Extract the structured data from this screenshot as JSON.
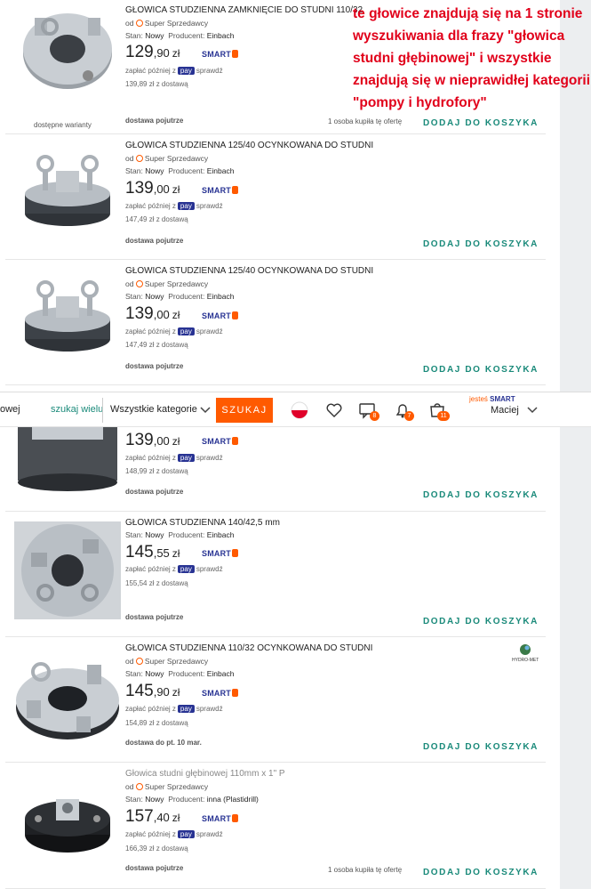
{
  "annotation": "te głowice znajdują się na 1 stronie wyszukiwania dla frazy \"głowica studni głębinowej\" i wszystkie znajdują się w nieprawidłej kategorii \"pompy i hydrofory\"",
  "common": {
    "seller_prefix": "od",
    "seller": "Super Sprzedawcy",
    "condition_label": "Stan:",
    "condition": "Nowy",
    "producer_label": "Producent:",
    "currency": "zł",
    "smart": "SMART",
    "pay_later_before": "zapłać później z",
    "pay": "pay",
    "pay_later_after": "sprawdź",
    "add_to_cart": "DODAJ DO KOSZYKA"
  },
  "listings": [
    {
      "title": "GŁOWICA STUDZIENNA ZAMKNIĘCIE DO STUDNI 110/32",
      "producer": "Einbach",
      "price_int": "129",
      "price_dec": ",90",
      "with_delivery": "139,89 zł z dostawą",
      "delivery": "dostawa pojutrze",
      "bought": "1 osoba kupiła tę ofertę",
      "variants": "dostępne warianty"
    },
    {
      "title": "GŁOWICA STUDZIENNA 125/40 OCYNKOWANA DO STUDNI",
      "producer": "Einbach",
      "price_int": "139",
      "price_dec": ",00",
      "with_delivery": "147,49 zł z dostawą",
      "delivery": "dostawa pojutrze"
    },
    {
      "title": "GŁOWICA STUDZIENNA 125/40 OCYNKOWANA DO STUDNI",
      "producer": "Einbach",
      "price_int": "139",
      "price_dec": ",00",
      "with_delivery": "147,49 zł z dostawą",
      "delivery": "dostawa pojutrze"
    },
    {
      "price_int": "139",
      "price_dec": ",00",
      "with_delivery": "148,99 zł z dostawą",
      "delivery": "dostawa pojutrze"
    },
    {
      "title": "GŁOWICA STUDZIENNA 140/42,5 mm",
      "producer": "Einbach",
      "price_int": "145",
      "price_dec": ",55",
      "with_delivery": "155,54 zł z dostawą",
      "delivery": "dostawa pojutrze"
    },
    {
      "title": "GŁOWICA STUDZIENNA 110/32 OCYNKOWANA DO STUDNI",
      "producer": "Einbach",
      "price_int": "145",
      "price_dec": ",90",
      "with_delivery": "154,89 zł z dostawą",
      "delivery": "dostawa do pt. 10 mar.",
      "brand_logo": "HYDRO-MET"
    },
    {
      "title": "Głowica studni głębinowej 110mm x 1\" P",
      "producer": "inna (Plastidrill)",
      "price_int": "157",
      "price_dec": ",40",
      "with_delivery": "166,39 zł z dostawą",
      "delivery": "dostawa pojutrze",
      "bought": "1 osoba kupiła tę ofertę"
    }
  ],
  "searchbar": {
    "query": "owej",
    "search_many": "szukaj wielu",
    "category": "Wszystkie kategorie",
    "search_button": "SZUKAJ",
    "messages_count": "8",
    "notifications_count": "7",
    "cart_count": "11",
    "jestes": "jesteś",
    "user": "Maciej"
  },
  "colors": {
    "accent": "#ff5a00",
    "teal": "#1a8a7a",
    "annotation_red": "#e1001a",
    "pay_blue": "#283393"
  }
}
